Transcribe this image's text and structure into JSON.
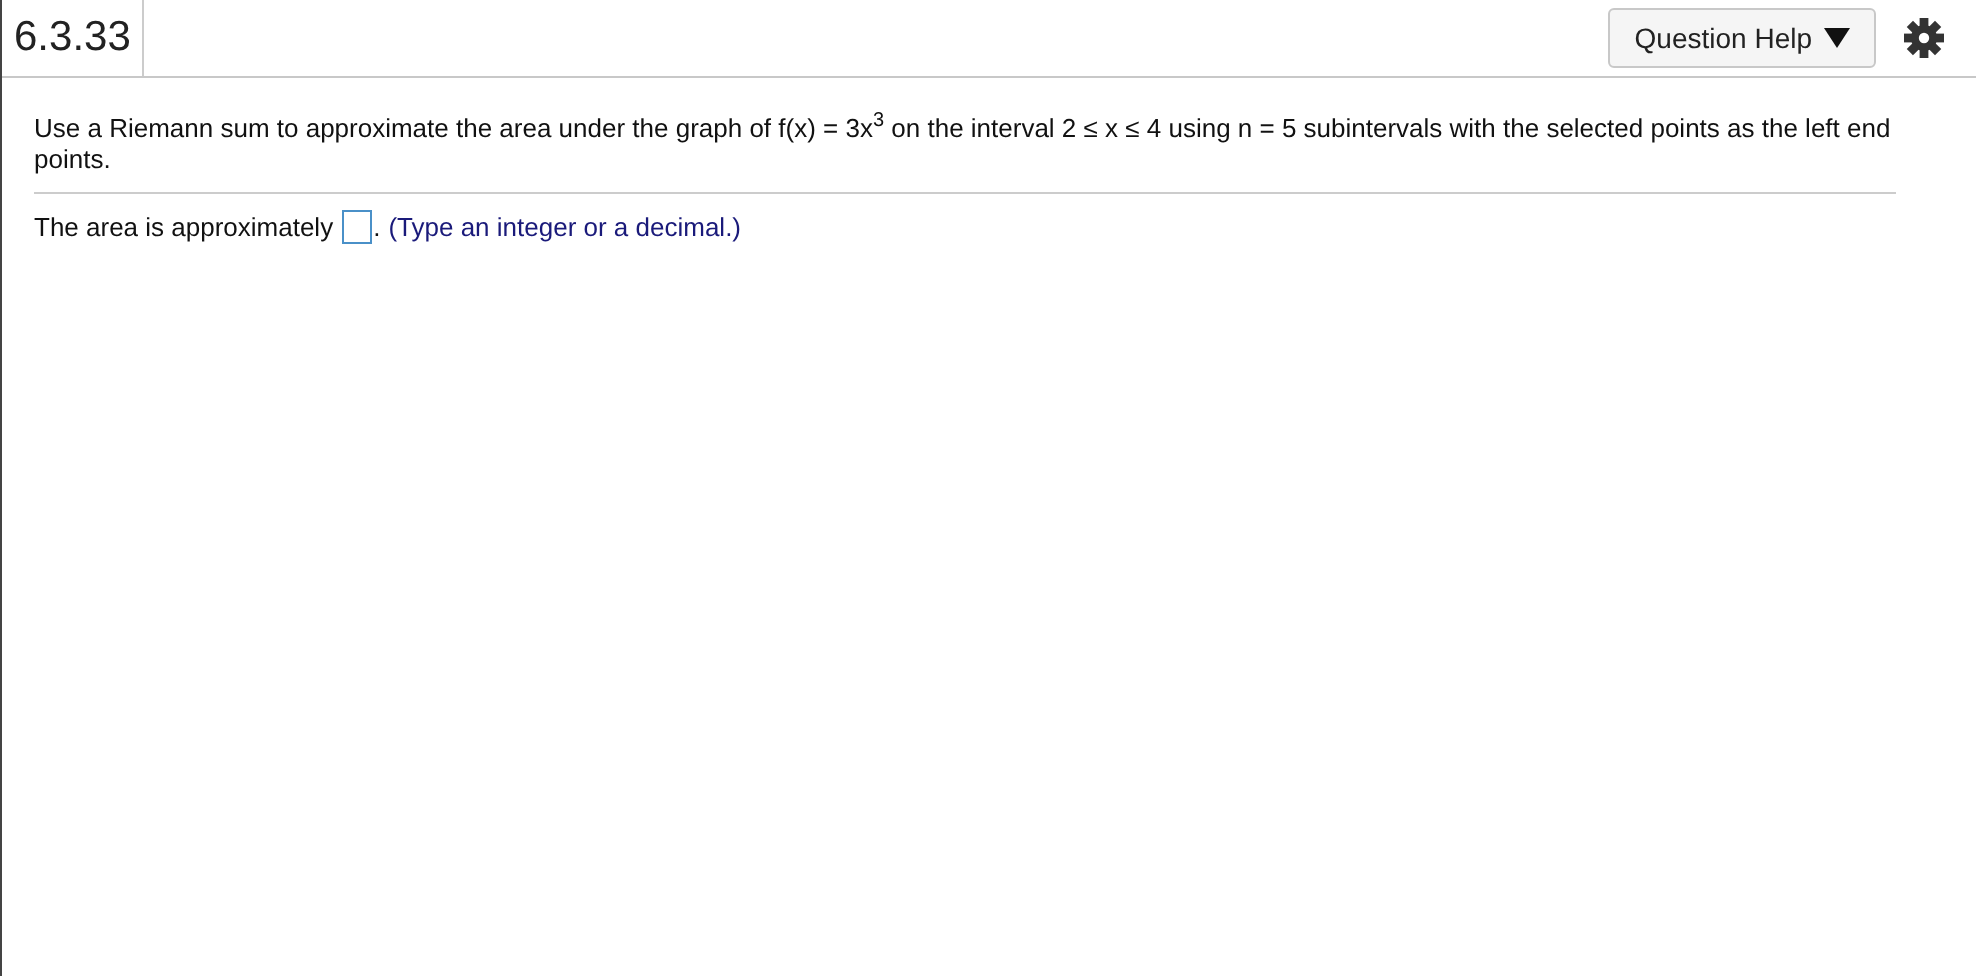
{
  "header": {
    "title": "6.3.33",
    "help_button": "Question Help"
  },
  "question": {
    "text": "Use a Riemann sum to approximate the area under the graph of f(x) = 3x$^{3}$ on the interval 2 ≤ x ≤ 4 using n = 5 subintervals with the selected points as the left end points."
  },
  "answer": {
    "prefix": "The area is approximately",
    "suffix": ".",
    "hint": "(Type an integer or a decimal.)"
  }
}
